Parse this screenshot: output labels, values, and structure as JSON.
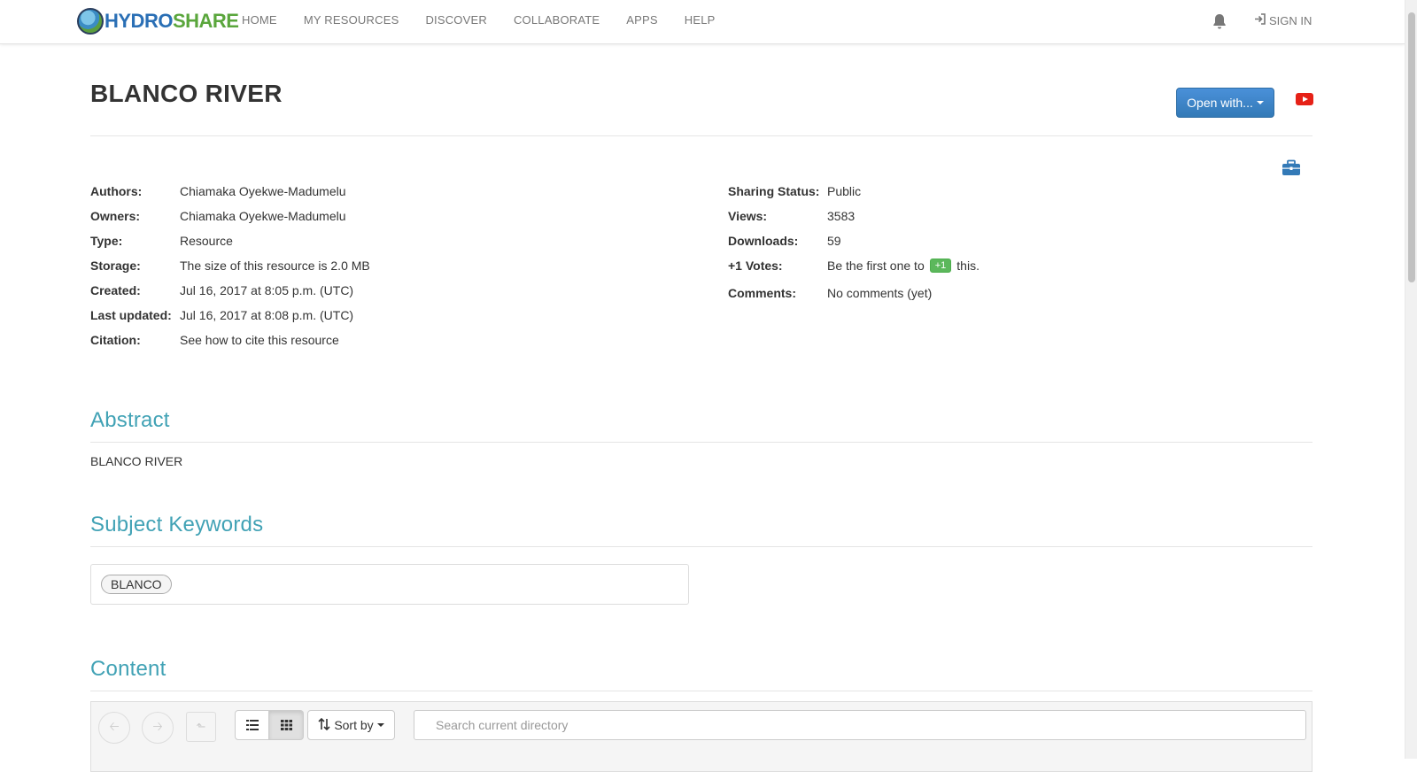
{
  "brand": {
    "name_part1": "HYDRO",
    "name_part2": "SHARE"
  },
  "nav": {
    "items": [
      "HOME",
      "MY RESOURCES",
      "DISCOVER",
      "COLLABORATE",
      "APPS",
      "HELP"
    ],
    "signin_label": "SIGN IN",
    "bell_icon": "bell-icon",
    "signin_icon": "sign-in-icon"
  },
  "resource": {
    "title": "BLANCO RIVER",
    "open_with_label": "Open with...",
    "youtube_icon": "youtube-icon",
    "toolbox_icon": "toolbox-icon"
  },
  "metadata_left": [
    {
      "label": "Authors:",
      "value": "Chiamaka Oyekwe-Madumelu",
      "link": true
    },
    {
      "label": "Owners:",
      "value": "Chiamaka Oyekwe-Madumelu",
      "link": true
    },
    {
      "label": "Type:",
      "value": "Resource",
      "link": false
    },
    {
      "label": "Storage:",
      "value": "The size of this resource is 2.0 MB",
      "link": false
    },
    {
      "label": "Created:",
      "value": "Jul 16, 2017 at 8:05 p.m. (UTC)",
      "link": false
    },
    {
      "label": "Last updated:",
      "value": "Jul 16, 2017 at 8:08 p.m. (UTC)",
      "link": false
    },
    {
      "label": "Citation:",
      "value": "See how to cite this resource",
      "link": true
    }
  ],
  "metadata_right": {
    "sharing": {
      "label": "Sharing Status:",
      "value": "Public"
    },
    "views": {
      "label": "Views:",
      "value": "3583"
    },
    "downloads": {
      "label": "Downloads:",
      "value": "59"
    },
    "votes": {
      "label": "+1 Votes:",
      "prefix": "Be the first one to",
      "button": "+1",
      "suffix": "this."
    },
    "comments": {
      "label": "Comments:",
      "value": "No comments (yet)"
    }
  },
  "abstract": {
    "heading": "Abstract",
    "text": "BLANCO RIVER"
  },
  "keywords": {
    "heading": "Subject Keywords",
    "items": [
      "BLANCO"
    ]
  },
  "content": {
    "heading": "Content",
    "sort_label": "Sort by",
    "search_placeholder": "Search current directory"
  },
  "colors": {
    "accent": "#41a2b5",
    "link": "#337ab7",
    "primary_button": "#337ab7",
    "vote_button": "#5cb85c"
  }
}
